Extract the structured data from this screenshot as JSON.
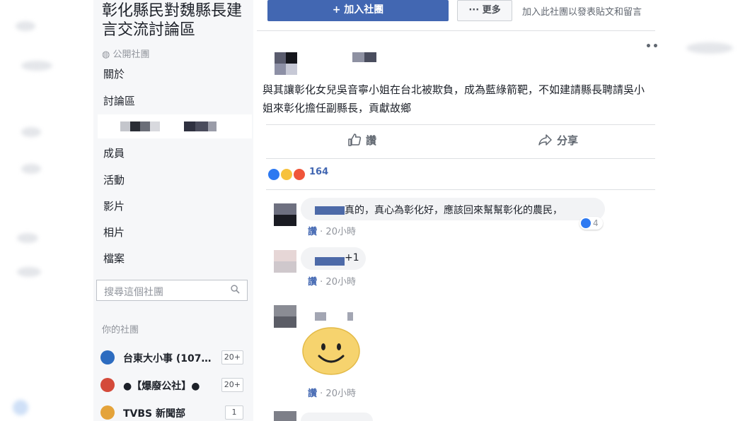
{
  "sidebar": {
    "group_title": "彰化縣民對魏縣長建言交流討論區",
    "privacy": "公開社團",
    "nav": [
      "關於",
      "討論區",
      "成員",
      "活動",
      "影片",
      "相片",
      "檔案"
    ],
    "search_placeholder": "搜尋這個社團",
    "your_groups_label": "你的社團",
    "groups": [
      {
        "name": "台東大小事 (107…",
        "badge": "20+",
        "icon": "group-avatar-icon"
      },
      {
        "name": "●【爆廢公社】●",
        "badge": "20+",
        "icon": "group-avatar-icon"
      },
      {
        "name": "TVBS 新聞部",
        "badge": "1",
        "icon": "group-avatar-icon"
      }
    ]
  },
  "header": {
    "join_label": "+ 加入社團",
    "more_label": "··· 更多",
    "join_hint": "加入此社團以發表貼文和留言"
  },
  "post": {
    "body": "與其讓彰化女兒吳音寧小姐在台北被欺負，成為藍綠箭靶，不如建請縣長聘請吳小姐來彰化擔任副縣長，貢獻故鄉",
    "like_label": "讚",
    "share_label": "分享",
    "reaction_count": "164"
  },
  "comments": [
    {
      "text": "真的，真心為彰化好，應該回來幫幫彰化的農民，",
      "like_label": "讚",
      "time": "20小時",
      "likes": "4"
    },
    {
      "text": "+1",
      "like_label": "讚",
      "time": "20小時"
    },
    {
      "like_label": "讚",
      "time": "20小時"
    }
  ],
  "colors": {
    "accent": "#4267b2",
    "sidebar_bg": "#f6f7f9"
  }
}
